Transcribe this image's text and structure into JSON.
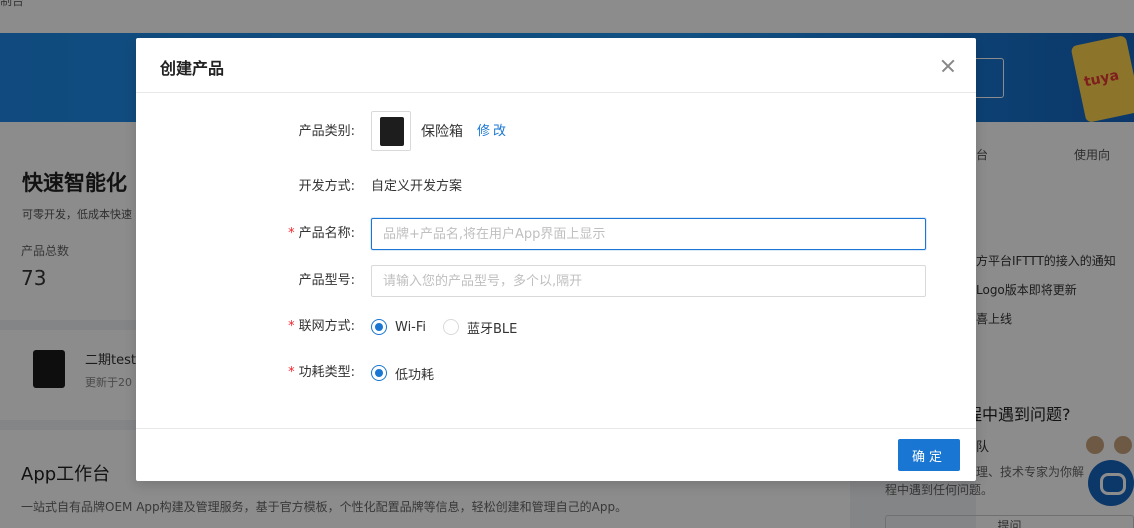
{
  "background": {
    "breadcrumb": "制台",
    "quick_title": "快速智能化",
    "quick_subtitle": "可零开发，低成本快速",
    "total_label": "产品总数",
    "total_value": "73",
    "card_name": "二期test",
    "card_updated": "更新于20",
    "app_title": "App工作台",
    "app_desc": "一站式自有品牌OEM App构建及管理服务，基于官方模板，个性化配置品牌等信息，轻松创建和管理自己的App。",
    "right_tab1": "台",
    "right_tab2": "使用向",
    "news": [
      "方平台IFTTT的接入的通知",
      "Logo版本即将更新",
      "喜上线"
    ],
    "help_title": "程中遇到问题?",
    "help_team": "队",
    "help_desc": "理、技术专家为你解",
    "help_desc2": "程中遇到任何问题。",
    "help_button": "提问",
    "badge_text": "tuya"
  },
  "modal": {
    "title": "创建产品",
    "category_label": "产品类别:",
    "category_value": "保险箱",
    "category_edit": "修改",
    "dev_label": "开发方式:",
    "dev_value": "自定义开发方案",
    "name_label": "产品名称:",
    "name_placeholder": "品牌+产品名,将在用户App界面上显示",
    "model_label": "产品型号:",
    "model_placeholder": "请输入您的产品型号，多个以,隔开",
    "network_label": "联网方式:",
    "network_options": [
      "Wi-Fi",
      "蓝牙BLE"
    ],
    "network_selected": "Wi-Fi",
    "power_label": "功耗类型:",
    "power_options": [
      "低功耗"
    ],
    "power_selected": "低功耗",
    "required_mark": "*",
    "ok_button": "确定"
  },
  "colors": {
    "primary": "#1976d2",
    "required": "#f5222d"
  }
}
